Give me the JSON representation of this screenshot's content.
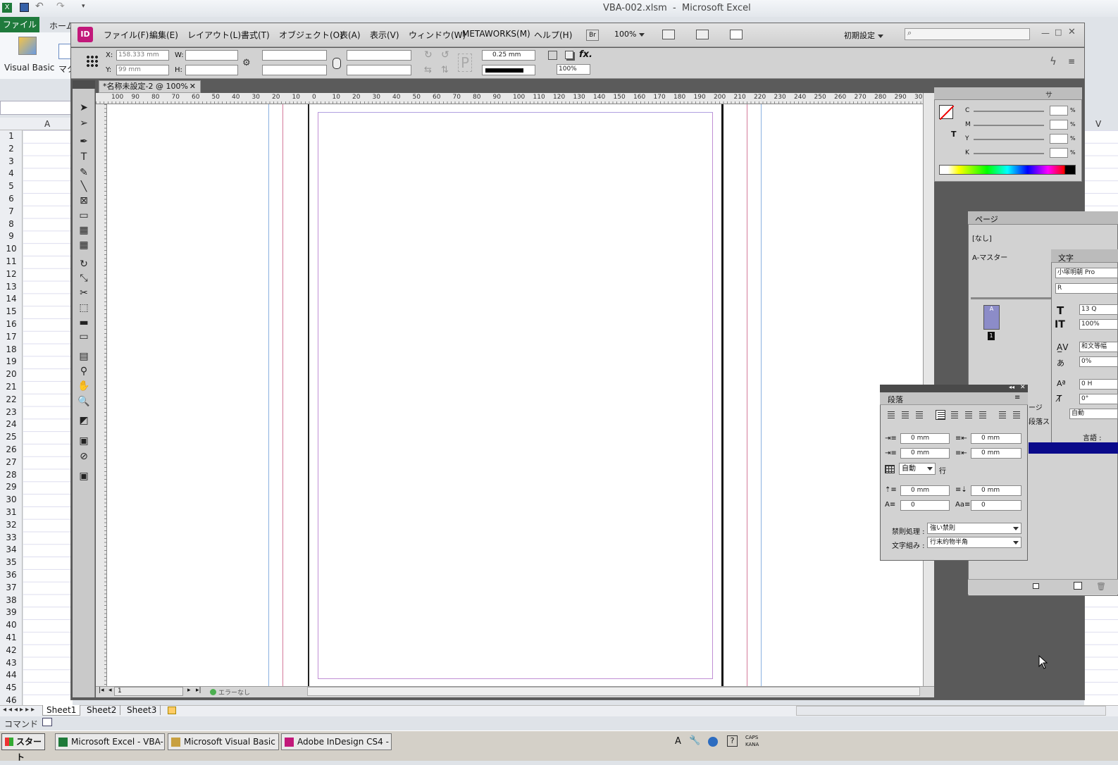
{
  "excel": {
    "window_title": "VBA-002.xlsm  -  Microsoft Excel",
    "file_tab": "ファイル",
    "home_tab": "ホーム",
    "ribbon_vb": "Visual Basic",
    "ribbon_macro": "マク",
    "column_a": "A",
    "column_v": "V",
    "rows": [
      "1",
      "2",
      "3",
      "4",
      "5",
      "6",
      "7",
      "8",
      "9",
      "10",
      "11",
      "12",
      "13",
      "14",
      "15",
      "16",
      "17",
      "18",
      "19",
      "20",
      "21",
      "22",
      "23",
      "24",
      "25",
      "26",
      "27",
      "28",
      "29",
      "30",
      "31",
      "32",
      "33",
      "34",
      "35",
      "36",
      "37",
      "38",
      "39",
      "40",
      "41",
      "42",
      "43",
      "44",
      "45",
      "46"
    ],
    "sheets": [
      "Sheet1",
      "Sheet2",
      "Sheet3"
    ],
    "status": "コマンド"
  },
  "indesign": {
    "logo": "ID",
    "menu": [
      "ファイル(F)",
      "編集(E)",
      "レイアウト(L)",
      "書式(T)",
      "オブジェクト(O)",
      "表(A)",
      "表示(V)",
      "ウィンドウ(W)",
      "METAWORKS(M)",
      "ヘルプ(H)"
    ],
    "br_label": "Br",
    "zoom": "100%",
    "workspace": "初期設定",
    "control": {
      "x_label": "X:",
      "x_value": "158.333 mm",
      "y_label": "Y:",
      "y_value": "99 mm",
      "w_label": "W:",
      "h_label": "H:",
      "stroke_weight": "0.25 mm",
      "opacity": "100%"
    },
    "doc_tab": "*名称未設定-2 @ 100%",
    "ruler_labels": [
      "100",
      "90",
      "80",
      "70",
      "60",
      "50",
      "40",
      "30",
      "20",
      "10",
      "0",
      "10",
      "20",
      "30",
      "40",
      "50",
      "60",
      "70",
      "80",
      "90",
      "100",
      "110",
      "120",
      "130",
      "140",
      "150",
      "160",
      "170",
      "180",
      "190",
      "200",
      "210",
      "220",
      "230",
      "240",
      "250",
      "260",
      "270",
      "280",
      "290",
      "300"
    ],
    "page_number": "1",
    "preflight": "エラーなし",
    "color_panel": {
      "tab_label": "サ",
      "c": "C",
      "m": "M",
      "y": "Y",
      "k": "K",
      "pct": "%"
    },
    "pages_panel": {
      "title": "ページ",
      "none": "[なし]",
      "master": "A-マスター",
      "page_label": "A",
      "page_num": "1"
    },
    "char_panel": {
      "title": "文字",
      "font": "小塚明朝 Pro",
      "style": "R",
      "size": "13 Q",
      "scale": "100%",
      "kerning": "和文等幅",
      "tracking": "0%",
      "baseline": "0 H",
      "skew": "0°",
      "auto": "自動",
      "lang": "言語 :"
    },
    "para_panel": {
      "title": "段落",
      "left_indent": "0 mm",
      "right_indent": "0 mm",
      "first_indent": "0 mm",
      "last_indent": "0 mm",
      "leading": "自動",
      "leading_unit": "行",
      "space_before": "0 mm",
      "space_after": "0 mm",
      "drop_lines": "0",
      "drop_chars": "0",
      "kinsoku_label": "禁則処理 :",
      "kinsoku_value": "強い禁則",
      "mojikumi_label": "文字組み :",
      "mojikumi_value": "行末約物半角",
      "page_tab": "ージ",
      "para_style_tab": "段落ス"
    }
  },
  "taskbar": {
    "start": "スタート",
    "items": [
      "Microsoft Excel - VBA-...",
      "Microsoft Visual Basic f...",
      "Adobe InDesign CS4 - *..."
    ],
    "tray_caps": "CAPS",
    "tray_kana": "KANA"
  }
}
